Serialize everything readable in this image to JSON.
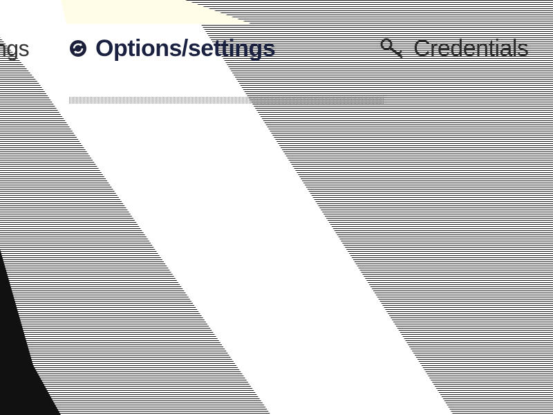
{
  "tabs": {
    "previous": {
      "label": "ngs"
    },
    "options": {
      "label": "Options/settings",
      "icon": "refresh-icon"
    },
    "credentials": {
      "label": "Credentials",
      "icon": "key-icon"
    }
  },
  "colors": {
    "active_tab_bg": "#fffde8",
    "text_dark": "#1b1f3a",
    "scanline": "#1a1a1a"
  }
}
